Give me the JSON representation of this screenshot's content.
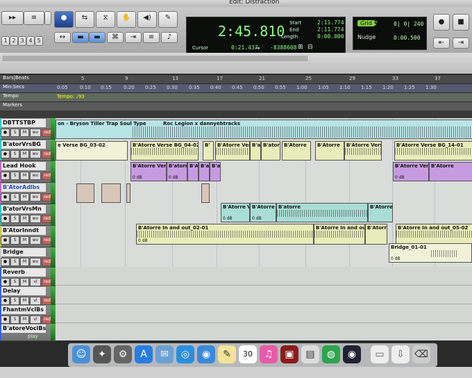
{
  "window": {
    "title": "Edit: Distraction"
  },
  "toolbar": {
    "counter": {
      "main_time": "2:45.810",
      "start_label": "Start",
      "end_label": "End",
      "length_label": "Length",
      "start": "2:11.774",
      "end": "2:11.774",
      "length": "0:00.000",
      "cursor_label": "Cursor",
      "cursor": "0:21.437",
      "cursor_sample": "-8388608"
    },
    "grid": {
      "grid_label": "Grid",
      "grid_value": "0| 0| 240",
      "nudge_label": "Nudge",
      "nudge_value": "0:00.500"
    },
    "num_buttons": [
      "1",
      "2",
      "3",
      "4",
      "5"
    ]
  },
  "rulers": {
    "bars_label": "Bars|Beats",
    "bars_ticks": [
      "5",
      "9",
      "13",
      "17",
      "21",
      "25",
      "29",
      "33",
      "37"
    ],
    "minsecs_label": "Min:Secs",
    "minsecs_ticks": [
      "0:05",
      "0:10",
      "0:15",
      "0:20",
      "0:25",
      "0:30",
      "0:35",
      "0:40",
      "0:45",
      "0:50",
      "0:55",
      "1:00",
      "1:05",
      "1:10",
      "1:15",
      "1:20",
      "1:25",
      "1:30"
    ],
    "tempo_label": "Tempo",
    "tempo_value": "Tempo: ♩93",
    "markers_label": "Markers"
  },
  "tracks": [
    {
      "name": "DBTTSTBP",
      "mode": "wv"
    },
    {
      "name": "B'atorVrsBG",
      "mode": "wv"
    },
    {
      "name": "Lead Hook",
      "mode": "wv"
    },
    {
      "name": "B'AtorAdlbs",
      "mode": "wv"
    },
    {
      "name": "B'atorVrsMn",
      "mode": "wv"
    },
    {
      "name": "B'AtorInndt",
      "mode": "wv"
    },
    {
      "name": "Bridge",
      "mode": "wv"
    },
    {
      "name": "Reverb",
      "mode": "vl"
    },
    {
      "name": "Delay",
      "mode": "vl"
    },
    {
      "name": "FhantmVclBs",
      "mode": "vl"
    },
    {
      "name": "B'atoreVoclBs",
      "mode": ""
    }
  ],
  "track_buttons": {
    "solo": "S",
    "mute": "M",
    "rec": "red",
    "status": "play"
  },
  "clips": {
    "beat_1": "on - Bryson Tiller Trap Soul Type",
    "beat_2": "Roc Legion x dannyebtracks",
    "vrsbg_1": "e Verse BG_03-02",
    "vrsbg_2": "B'Atorre Verse BG_04-02",
    "vrsbg_3": "B'",
    "vrsbg_4": "B'Atorre Vers",
    "vrsbg_5": "B'a",
    "vrsbg_6": "B'atorr",
    "vrsbg_7": "B'Atorre",
    "vrsbg_8": "B'Atorre",
    "vrsbg_9": "B'Atorre Vers",
    "vrsbg_10": "B'Atorre Verse BG_14-01",
    "hook_1": "B'Atorre Verse",
    "hook_2": "B'atorr",
    "hook_3": "B'Atorre",
    "hook_4": "B'a",
    "hook_5": "B'a",
    "hook_6": "B'Atorre Verse",
    "hook_7": "B'Atorre",
    "vrsmn_1": "B'Atorre Vs",
    "vrsmn_2": "B'Atorre V",
    "vrsmn_3": "B'atorre",
    "vrsmn_4": "B'Atorre",
    "inndt_1": "B'Atorre In and out_02-01",
    "inndt_2": "B'Atorre In and out",
    "inndt_3": "B'Atorr",
    "inndt_4": "B'Atorre In and out_05-02",
    "bridge_1": "Bridge_01-01",
    "gain": "0 dB"
  },
  "dock": {
    "icons": [
      "finder-icon",
      "launchpad-icon",
      "rocket-icon",
      "app-store-icon",
      "mail-icon",
      "safari-icon",
      "photo-icon",
      "notes-icon",
      "calendar-icon",
      "itunes-icon",
      "photo-booth-icon",
      "preview-icon",
      "chrome-icon",
      "protools-icon",
      "folder-icon",
      "downloads-icon",
      "trash-icon"
    ],
    "calendar_date": "30"
  },
  "colors": {
    "accent": "#3a6bd0",
    "counter_green": "#8dff82",
    "clip_cyan": "#a9ddd5",
    "clip_purple": "#c79be0",
    "clip_yellow": "#e8ecb8"
  }
}
